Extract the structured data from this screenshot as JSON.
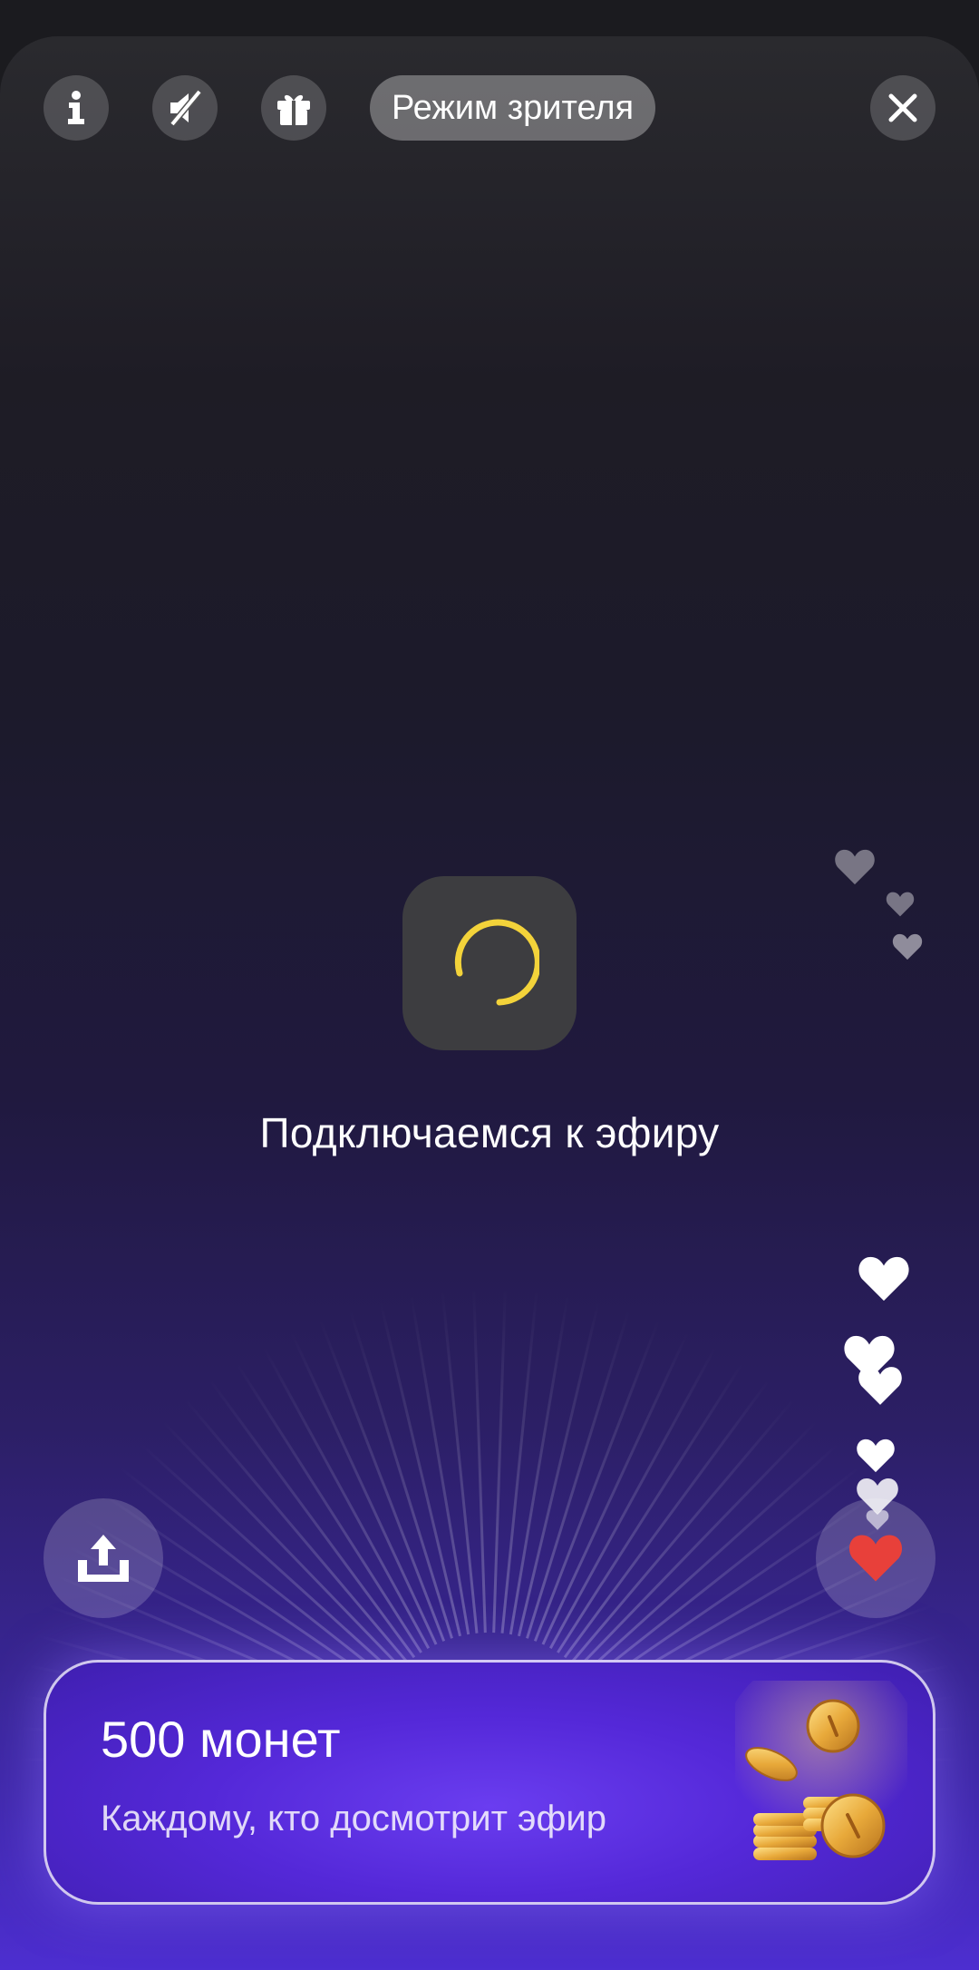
{
  "header": {
    "mode_label": "Режим зрителя",
    "icons": [
      "info-icon",
      "sound-muted-icon",
      "gift-icon",
      "close-icon"
    ]
  },
  "stream": {
    "status_text": "Подключаемся к эфиру",
    "loader_color": "#f3d33a"
  },
  "actions": {
    "share_icon": "share-icon",
    "like_icon": "heart-icon",
    "like_color": "#e8403a"
  },
  "promo": {
    "title": "500 монет",
    "subtitle": "Каждому, кто досмотрит эфир",
    "icon": "coins-icon"
  },
  "colors": {
    "accent": "#5a2ee0",
    "background_top": "#2a2a2e",
    "background_bottom": "#4d2ed0"
  }
}
